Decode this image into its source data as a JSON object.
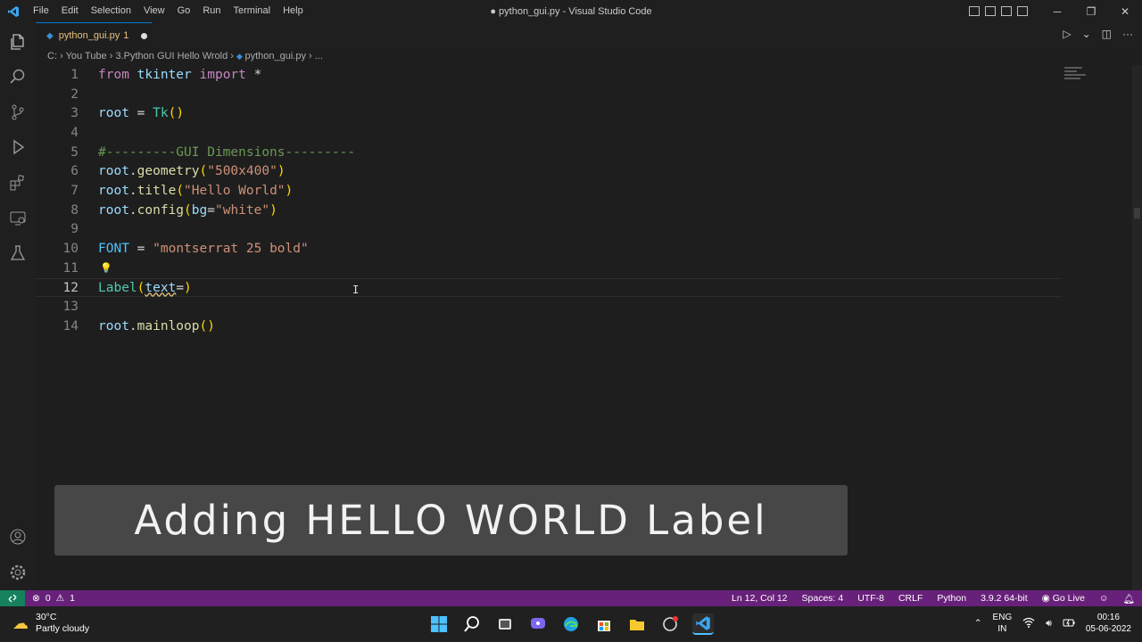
{
  "window": {
    "title": "● python_gui.py - Visual Studio Code"
  },
  "menu": [
    "File",
    "Edit",
    "Selection",
    "View",
    "Go",
    "Run",
    "Terminal",
    "Help"
  ],
  "tab": {
    "label": "python_gui.py",
    "badge": "1"
  },
  "breadcrumb": [
    "C:",
    "You Tube",
    "3.Python GUI Hello Wrold",
    "python_gui.py",
    "..."
  ],
  "editor": {
    "current_line": 12,
    "lines": [
      {
        "n": "1",
        "text": "from tkinter import *"
      },
      {
        "n": "2",
        "text": ""
      },
      {
        "n": "3",
        "text": "root = Tk()"
      },
      {
        "n": "4",
        "text": ""
      },
      {
        "n": "5",
        "text": "#---------GUI Dimensions---------"
      },
      {
        "n": "6",
        "text": "root.geometry(\"500x400\")"
      },
      {
        "n": "7",
        "text": "root.title(\"Hello World\")"
      },
      {
        "n": "8",
        "text": "root.config(bg=\"white\")"
      },
      {
        "n": "9",
        "text": ""
      },
      {
        "n": "10",
        "text": "FONT = \"montserrat 25 bold\""
      },
      {
        "n": "11",
        "text": ""
      },
      {
        "n": "12",
        "text": "Label(text=)"
      },
      {
        "n": "13",
        "text": ""
      },
      {
        "n": "14",
        "text": "root.mainloop()"
      }
    ]
  },
  "caption": "Adding HELLO WORLD Label",
  "status": {
    "errors": "0",
    "warnings": "1",
    "position": "Ln 12, Col 12",
    "spaces": "Spaces: 4",
    "encoding": "UTF-8",
    "eol": "CRLF",
    "language": "Python",
    "interpreter": "3.9.2 64-bit",
    "golive": "Go Live"
  },
  "taskbar": {
    "temp": "30°C",
    "weather": "Partly cloudy",
    "lang1": "ENG",
    "lang2": "IN",
    "time": "00:16",
    "date": "05-06-2022"
  },
  "colors": {
    "accent": "#0078d4",
    "statusbar": "#68217a",
    "remote": "#16825d"
  }
}
